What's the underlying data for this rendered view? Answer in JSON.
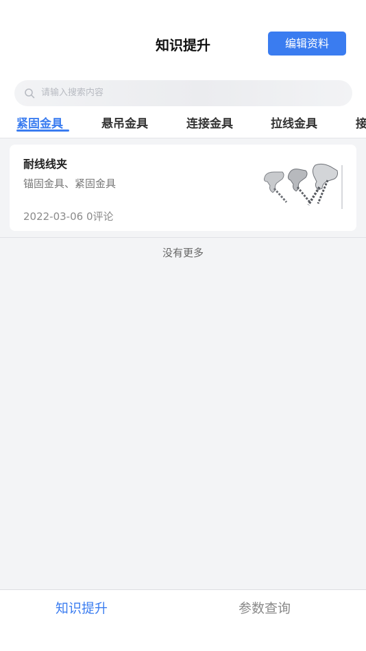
{
  "header": {
    "title": "知识提升",
    "edit_button": "编辑资料"
  },
  "search": {
    "placeholder": "请输入搜索内容",
    "icon": "search-icon"
  },
  "category_tabs": [
    {
      "label": "紧固金具",
      "active": true
    },
    {
      "label": "悬吊金具",
      "active": false
    },
    {
      "label": "连接金具",
      "active": false
    },
    {
      "label": "拉线金具",
      "active": false
    },
    {
      "label": "接",
      "active": false
    }
  ],
  "articles": [
    {
      "title": "耐线线夹",
      "tags": "锚固金具、紧固金具",
      "meta": "2022-03-06 0评论",
      "thumbnail": "tension-clamp-image"
    }
  ],
  "list_end_text": "没有更多",
  "bottom_tabs": [
    {
      "label": "知识提升",
      "active": true
    },
    {
      "label": "参数查询",
      "active": false
    }
  ],
  "colors": {
    "accent": "#3a7cf0",
    "background": "#f3f4f6"
  }
}
